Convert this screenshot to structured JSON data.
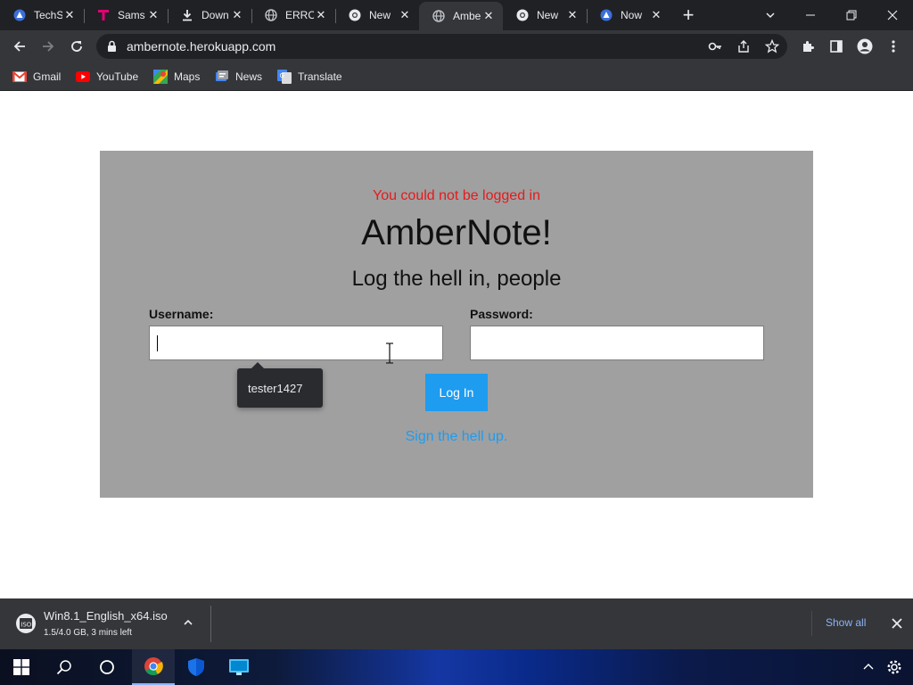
{
  "browser": {
    "tabs": [
      {
        "title": "TechS",
        "icon": "hub-icon",
        "active": false
      },
      {
        "title": "Sams",
        "icon": "t-mobile-icon",
        "active": false
      },
      {
        "title": "Down",
        "icon": "download-icon",
        "active": false
      },
      {
        "title": "ERRO",
        "icon": "globe-icon",
        "active": false
      },
      {
        "title": "New",
        "icon": "chrome-icon",
        "active": false
      },
      {
        "title": "Ambe",
        "icon": "globe-icon",
        "active": true
      },
      {
        "title": "New",
        "icon": "chrome-icon",
        "active": false
      },
      {
        "title": "Now",
        "icon": "hub-icon",
        "active": false
      }
    ],
    "address": "ambernote.herokuapp.com",
    "bookmarks": [
      {
        "label": "Gmail",
        "icon": "gmail-icon"
      },
      {
        "label": "YouTube",
        "icon": "youtube-icon"
      },
      {
        "label": "Maps",
        "icon": "maps-icon"
      },
      {
        "label": "News",
        "icon": "news-icon"
      },
      {
        "label": "Translate",
        "icon": "translate-icon"
      }
    ]
  },
  "page": {
    "error": "You could not be logged in",
    "brand": "AmberNote!",
    "tagline": "Log the hell in, people",
    "username_label": "Username:",
    "username_value": "",
    "password_label": "Password:",
    "password_value": "",
    "login_button": "Log In",
    "signup_link": "Sign the hell up.",
    "autofill_suggestion": "tester1427"
  },
  "download": {
    "filename": "Win8.1_English_x64.iso",
    "status": "1.5/4.0 GB, 3 mins left",
    "show_all": "Show all"
  },
  "colors": {
    "error": "#e8191b",
    "accent": "#1e9cf0",
    "panel": "#a0a0a0",
    "chrome_dark": "#202124",
    "chrome_mid": "#35363a"
  }
}
